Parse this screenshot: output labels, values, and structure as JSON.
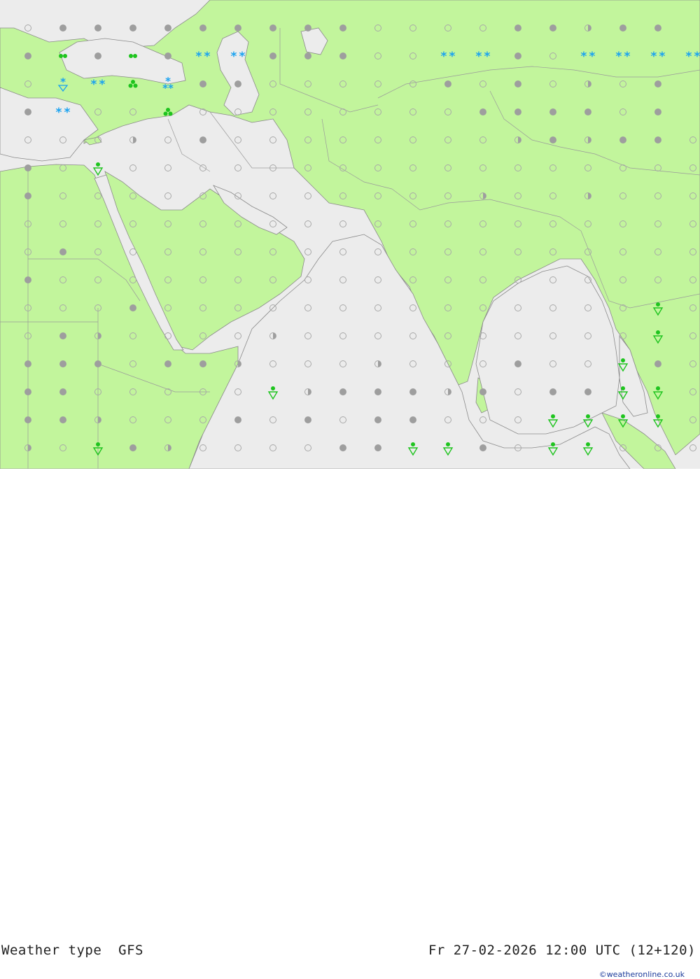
{
  "header": {
    "map_title": "Weather type",
    "model": "GFS",
    "valid_time": "Fr 27-02-2026 12:00 UTC (12+120)",
    "credit": "©weatheronline.co.uk"
  },
  "colors": {
    "land": "#c2f59c",
    "sea": "#ececec",
    "border": "#9a9a9a",
    "coast": "#8a8a8a",
    "snow": "#1aa2f0",
    "rain": "#1ec41e",
    "overcast": "#9e9e9e",
    "symbol_outline": "#a8a8a8"
  },
  "legend_symbol_names": [
    "clear-circle",
    "partly-cloudy-circle",
    "overcast-circle",
    "snow-icon",
    "rain-icon",
    "shower-icon"
  ],
  "symbol_grid": {
    "rows": [
      [
        "o",
        "c",
        "c",
        "c",
        "c",
        "c",
        "c",
        "c",
        "c",
        "c",
        "o",
        "o",
        "o",
        "o",
        "c",
        "c",
        "h",
        "c",
        "c"
      ],
      [
        "c",
        "R",
        "c",
        "R",
        "c",
        "S",
        "S",
        "c",
        "c",
        "c",
        "o",
        "o",
        "S",
        "S",
        "c",
        "o",
        "S",
        "S",
        "S",
        "S"
      ],
      [
        "o",
        "SR",
        "S",
        "T",
        "SS",
        "c",
        "c",
        "o",
        "o",
        "o",
        "o",
        "o",
        "c",
        "o",
        "c",
        "o",
        "h",
        "o",
        "c"
      ],
      [
        "c",
        "S",
        "o",
        "o",
        "T",
        "o",
        "o",
        "o",
        "o",
        "o",
        "o",
        "o",
        "o",
        "c",
        "c",
        "c",
        "c",
        "o",
        "c"
      ],
      [
        "o",
        "o",
        "O",
        "h",
        "o",
        "c",
        "o",
        "o",
        "o",
        "o",
        "o",
        "o",
        "o",
        "o",
        "h",
        "c",
        "h",
        "c",
        "c",
        "o"
      ],
      [
        "c",
        "o",
        "Rs",
        "o",
        "o",
        "o",
        "o",
        "o",
        "o",
        "o",
        "o",
        "o",
        "o",
        "o",
        "o",
        "o",
        "o",
        "o",
        "o",
        "o"
      ],
      [
        "c",
        "o",
        "o",
        "o",
        "o",
        "o",
        "o",
        "o",
        "o",
        "o",
        "o",
        "o",
        "o",
        "h",
        "o",
        "o",
        "h",
        "o",
        "o",
        "o"
      ],
      [
        "o",
        "o",
        "o",
        "o",
        "o",
        "o",
        "o",
        "o",
        "o",
        "o",
        "o",
        "o",
        "o",
        "o",
        "o",
        "o",
        "o",
        "o",
        "o",
        "o"
      ],
      [
        "o",
        "c",
        "o",
        "o",
        "o",
        "o",
        "o",
        "o",
        "o",
        "o",
        "o",
        "o",
        "o",
        "o",
        "o",
        "o",
        "o",
        "o",
        "o",
        "o"
      ],
      [
        "c",
        "o",
        "o",
        "o",
        "o",
        "o",
        "o",
        "o",
        "o",
        "o",
        "o",
        "o",
        "o",
        "o",
        "o",
        "o",
        "o",
        "o",
        "o",
        "o"
      ],
      [
        "o",
        "o",
        "o",
        "c",
        "o",
        "o",
        "o",
        "o",
        "o",
        "o",
        "o",
        "o",
        "o",
        "o",
        "o",
        "o",
        "o",
        "o",
        "Rs",
        "o"
      ],
      [
        "o",
        "c",
        "h",
        "o",
        "o",
        "o",
        "o",
        "h",
        "o",
        "o",
        "o",
        "o",
        "o",
        "o",
        "o",
        "o",
        "o",
        "o",
        "Rs",
        "o"
      ],
      [
        "c",
        "c",
        "c",
        "o",
        "c",
        "c",
        "h",
        "o",
        "o",
        "o",
        "h",
        "o",
        "o",
        "o",
        "c",
        "o",
        "o",
        "Rs",
        "c",
        "o"
      ],
      [
        "c",
        "c",
        "o",
        "o",
        "o",
        "o",
        "o",
        "Rs",
        "h",
        "c",
        "c",
        "c",
        "h",
        "c",
        "o",
        "c",
        "c",
        "Rs",
        "Rs",
        "o"
      ],
      [
        "c",
        "c",
        "h",
        "o",
        "o",
        "o",
        "c",
        "o",
        "c",
        "o",
        "c",
        "c",
        "o",
        "o",
        "o",
        "Rs",
        "Rs",
        "Rs",
        "Rs",
        "o"
      ],
      [
        "h",
        "o",
        "Rs",
        "c",
        "h",
        "o",
        "o",
        "o",
        "o",
        "c",
        "c",
        "Rs",
        "Rs",
        "c",
        "o",
        "Rs",
        "Rs",
        "o",
        "o",
        "o"
      ]
    ]
  }
}
